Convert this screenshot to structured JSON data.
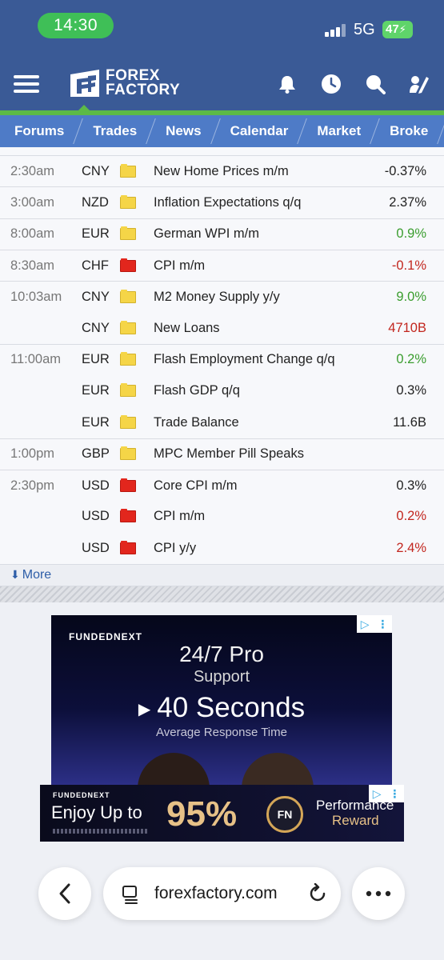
{
  "status": {
    "time": "14:30",
    "network": "5G",
    "battery": "47"
  },
  "header": {
    "logo_line1": "FOREX",
    "logo_line2": "FACTORY"
  },
  "tabs": [
    {
      "label": "Forums"
    },
    {
      "label": "Trades"
    },
    {
      "label": "News"
    },
    {
      "label": "Calendar"
    },
    {
      "label": "Market"
    },
    {
      "label": "Broke"
    }
  ],
  "calendar": {
    "rows": [
      {
        "time": "2:30am",
        "currency": "CNY",
        "impact": "yellow",
        "event": "New Home Prices m/m",
        "actual": "-0.37%",
        "actual_color": ""
      },
      {
        "time": "3:00am",
        "currency": "NZD",
        "impact": "yellow",
        "event": "Inflation Expectations q/q",
        "actual": "2.37%",
        "actual_color": ""
      },
      {
        "time": "8:00am",
        "currency": "EUR",
        "impact": "yellow",
        "event": "German WPI m/m",
        "actual": "0.9%",
        "actual_color": "green"
      },
      {
        "time": "8:30am",
        "currency": "CHF",
        "impact": "red",
        "event": "CPI m/m",
        "actual": "-0.1%",
        "actual_color": "red"
      },
      {
        "time": "10:03am",
        "currency": "CNY",
        "impact": "yellow",
        "event": "M2 Money Supply y/y",
        "actual": "9.0%",
        "actual_color": "green"
      },
      {
        "time": "",
        "currency": "CNY",
        "impact": "yellow",
        "event": "New Loans",
        "actual": "4710B",
        "actual_color": "red"
      },
      {
        "time": "11:00am",
        "currency": "EUR",
        "impact": "yellow",
        "event": "Flash Employment Change q/q",
        "actual": "0.2%",
        "actual_color": "green"
      },
      {
        "time": "",
        "currency": "EUR",
        "impact": "yellow",
        "event": "Flash GDP q/q",
        "actual": "0.3%",
        "actual_color": ""
      },
      {
        "time": "",
        "currency": "EUR",
        "impact": "yellow",
        "event": "Trade Balance",
        "actual": "11.6B",
        "actual_color": ""
      },
      {
        "time": "1:00pm",
        "currency": "GBP",
        "impact": "yellow",
        "event": "MPC Member Pill Speaks",
        "actual": "",
        "actual_color": ""
      },
      {
        "time": "2:30pm",
        "currency": "USD",
        "impact": "red",
        "event": "Core CPI m/m",
        "actual": "0.3%",
        "actual_color": ""
      },
      {
        "time": "",
        "currency": "USD",
        "impact": "red",
        "event": "CPI m/m",
        "actual": "0.2%",
        "actual_color": "red"
      },
      {
        "time": "",
        "currency": "USD",
        "impact": "red",
        "event": "CPI y/y",
        "actual": "2.4%",
        "actual_color": "red"
      }
    ],
    "more_label": "More"
  },
  "ad_main": {
    "brand": "FUNDEDNEXT",
    "line1": "24/7 Pro",
    "line2": "Support",
    "line3": "40 Seconds",
    "line4": "Average Response Time"
  },
  "ad_banner": {
    "brand": "FUNDEDNEXT",
    "enjoy": "Enjoy Up to",
    "percent": "95%",
    "coin": "FN",
    "perf_line1": "Performance",
    "perf_line2": "Reward"
  },
  "browser": {
    "url": "forexfactory.com"
  },
  "colors": {
    "header": "#3a5a96",
    "tabs": "#4e7bc7",
    "accent_green": "#5cba47",
    "positive": "#3a9d2e",
    "negative": "#c2261e"
  }
}
